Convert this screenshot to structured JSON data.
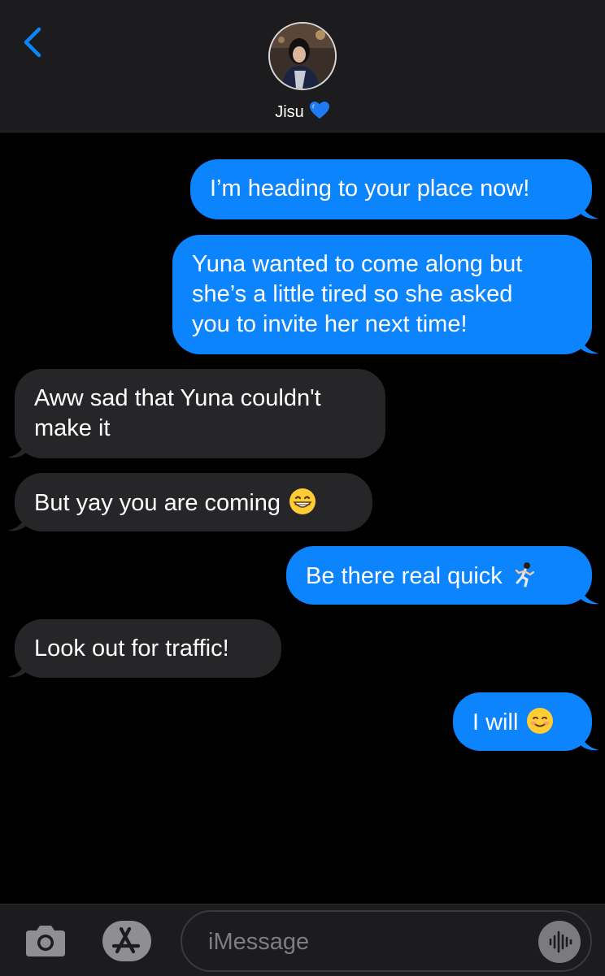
{
  "header": {
    "contact_name": "Jisu",
    "name_emoji": "blue-heart",
    "back_icon": "chevron-left-icon"
  },
  "messages": [
    {
      "direction": "outgoing",
      "lines": [
        "I’m heading to your place now!"
      ]
    },
    {
      "direction": "outgoing",
      "lines": [
        "Yuna wanted to come along but",
        "she’s a little tired so she asked",
        "you to invite her next time!"
      ]
    },
    {
      "direction": "incoming",
      "lines": [
        "Aww sad that Yuna couldn't",
        "make it"
      ]
    },
    {
      "direction": "incoming",
      "lines": [
        "But yay you are coming"
      ],
      "emoji": "grinning-face"
    },
    {
      "direction": "outgoing",
      "lines": [
        "Be there real quick"
      ],
      "emoji": "person-running"
    },
    {
      "direction": "incoming",
      "lines": [
        "Look out for traffic!"
      ]
    },
    {
      "direction": "outgoing",
      "lines": [
        "I will"
      ],
      "emoji": "smiling-face"
    }
  ],
  "input_bar": {
    "placeholder": "iMessage",
    "camera_icon": "camera-icon",
    "appstore_icon": "app-store-icon",
    "audio_icon": "audio-waveform-icon"
  },
  "colors": {
    "outgoing_bubble": "#0b84fe",
    "incoming_bubble": "#262628",
    "accent": "#0b84fe",
    "background": "#000000"
  }
}
